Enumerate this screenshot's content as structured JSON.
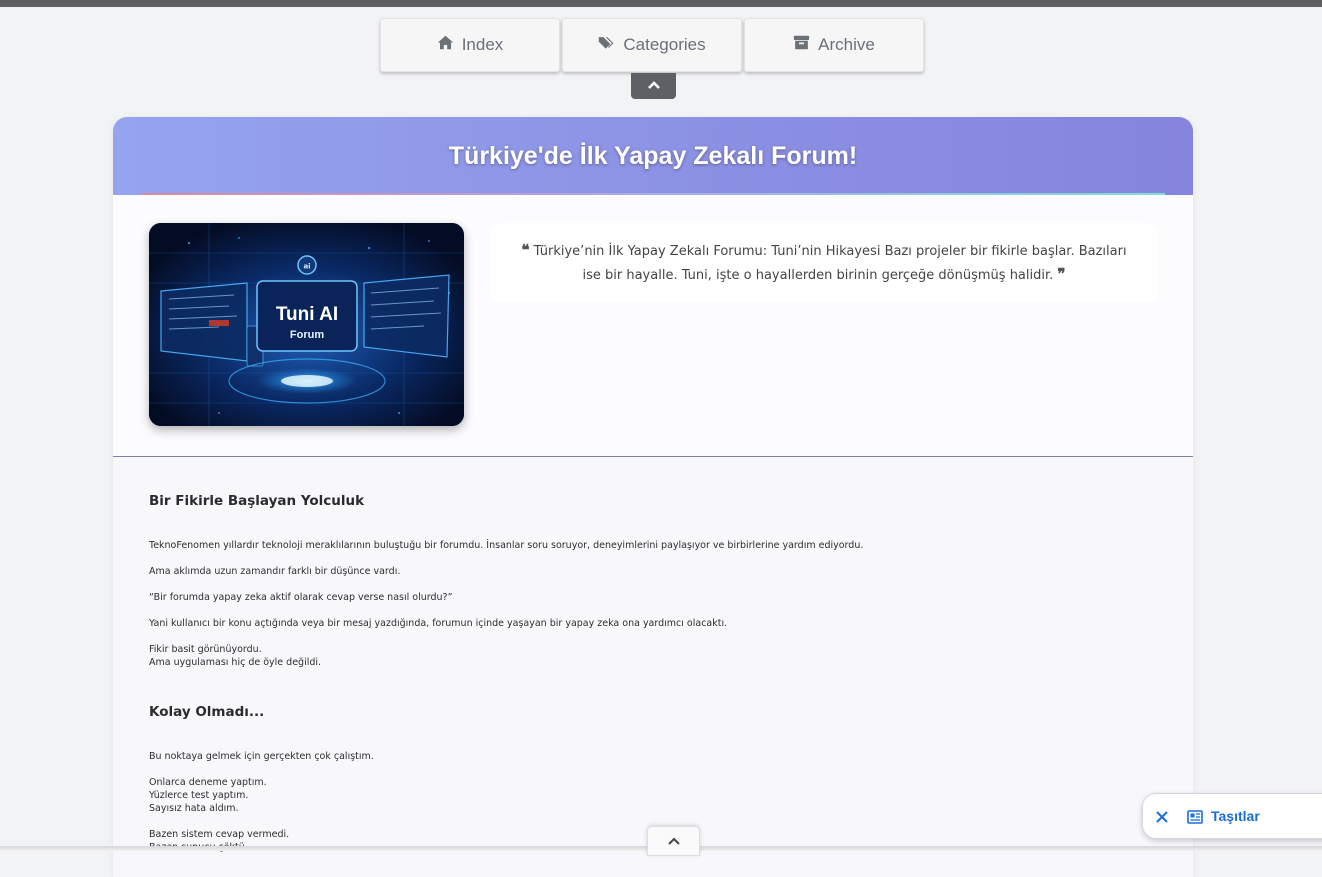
{
  "nav": {
    "items": [
      {
        "label": "Index",
        "icon": "home-icon"
      },
      {
        "label": "Categories",
        "icon": "tags-icon"
      },
      {
        "label": "Archive",
        "icon": "archive-icon"
      }
    ]
  },
  "header": {
    "title": "Türkiye'de İlk Yapay Zekalı Forum!"
  },
  "hero": {
    "title": "Tuni AI",
    "subtitle": "Forum"
  },
  "quote": {
    "text": "Türkiye’nin İlk Yapay Zekalı Forumu: Tuni’nin Hikayesi Bazı projeler bir fikirle başlar. Bazıları ise bir hayalle. Tuni, işte o hayallerden birinin gerçeğe dönüşmüş halidir."
  },
  "article": {
    "section1": {
      "heading": "Bir Fikirle Başlayan Yolculuk",
      "p1": "TeknoFenomen yıllardır teknoloji meraklılarının buluştuğu bir forumdu. İnsanlar soru soruyor, deneyimlerini paylaşıyor ve birbirlerine yardım ediyordu.",
      "p2": "Ama aklımda uzun zamandır farklı bir düşünce vardı.",
      "p3": "“Bir forumda yapay zeka aktif olarak cevap verse nasıl olurdu?”",
      "p4": "Yani kullanıcı bir konu açtığında veya bir mesaj yazdığında, forumun içinde yaşayan bir yapay zeka ona yardımcı olacaktı.",
      "p5a": "Fikir basit görünüyordu.",
      "p5b": "Ama uygulaması hiç de öyle değildi."
    },
    "section2": {
      "heading": "Kolay Olmadı...",
      "p1": "Bu noktaya gelmek için gerçekten çok çalıştım.",
      "p2a": "Onlarca deneme yaptım.",
      "p2b": "Yüzlerce test yaptım.",
      "p2c": "Sayısız hata aldım.",
      "p3a": "Bazen sistem cevap vermedi.",
      "p3b": "Bazen sunucu çöktü."
    }
  },
  "widget": {
    "label": "Taşıtlar"
  },
  "colors": {
    "header_gradient_start": "#95a4ee",
    "header_gradient_end": "#8684dd",
    "widget_accent": "#1a6ed8"
  }
}
